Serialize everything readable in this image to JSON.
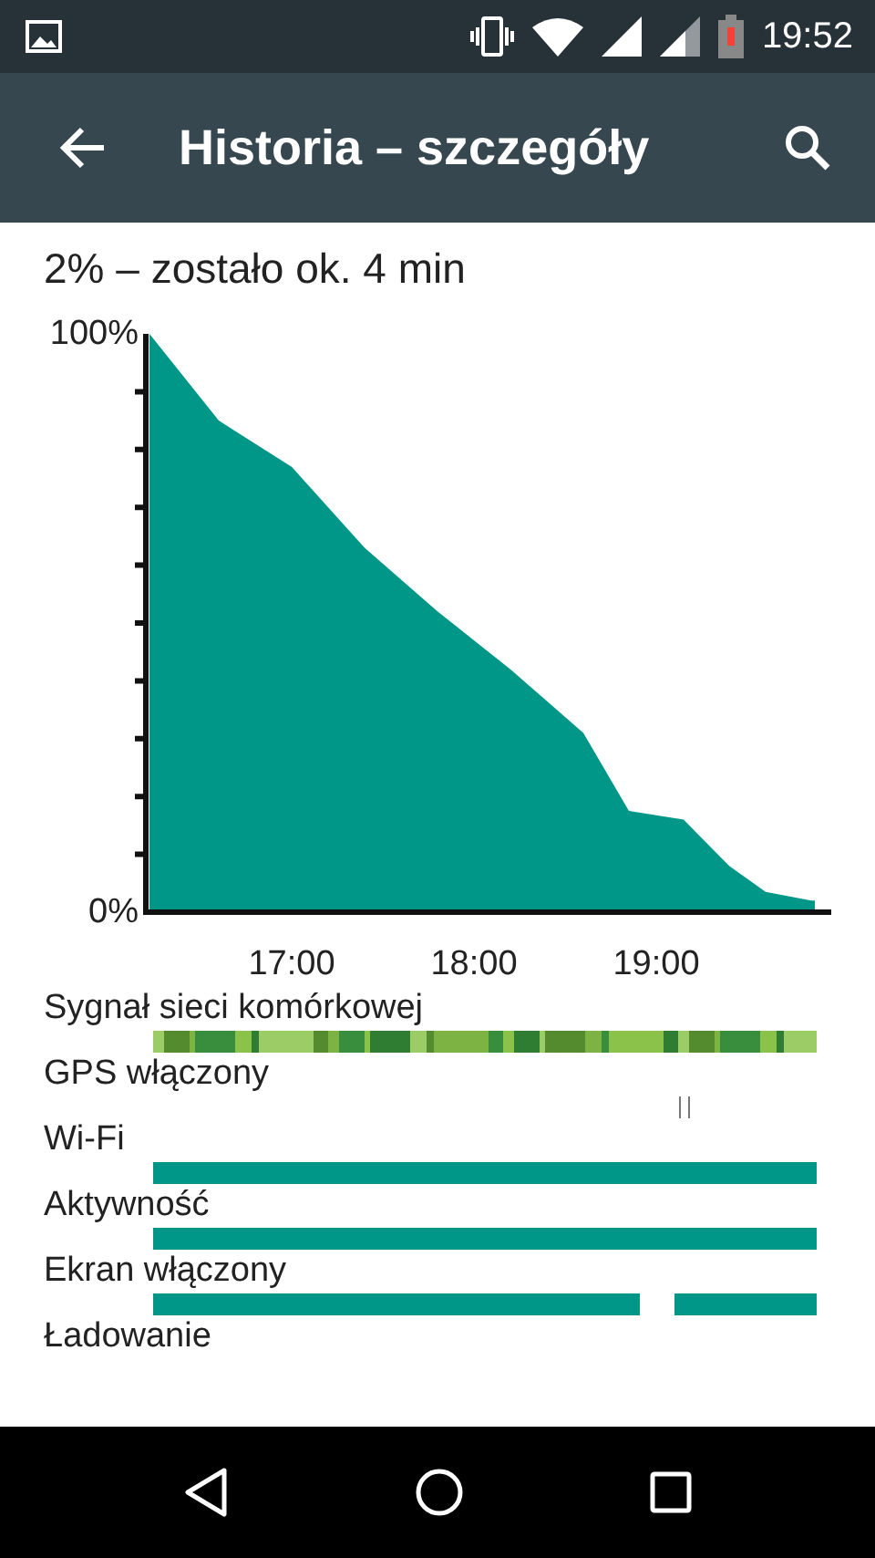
{
  "status_bar": {
    "time": "19:52"
  },
  "toolbar": {
    "title": "Historia – szczegóły"
  },
  "summary": "2% – zostało ok. 4 min",
  "chart": {
    "chart_data": {
      "type": "area",
      "x": [
        16.22,
        16.6,
        17,
        17.4,
        17.8,
        18.2,
        18.6,
        18.85,
        19.15,
        19.4,
        19.6,
        19.85
      ],
      "series": [
        {
          "color": "#009688",
          "values": [
            100,
            85,
            77,
            63,
            52,
            42,
            31,
            17.5,
            16,
            8,
            3.5,
            2
          ]
        }
      ],
      "xlim": [
        16.2,
        19.95
      ],
      "ylim": [
        0,
        100
      ],
      "xticks": [
        {
          "value": 17,
          "label": "17:00"
        },
        {
          "value": 18,
          "label": "18:00"
        },
        {
          "value": 19,
          "label": "19:00"
        }
      ],
      "yticks": [
        {
          "value": 0,
          "label": "0%"
        },
        {
          "value": 100,
          "label": "100%"
        }
      ]
    }
  },
  "usage_rows": [
    {
      "label": "Sygnał sieci komórkowej",
      "kind": "signal"
    },
    {
      "label": "GPS włączony",
      "kind": "ticks"
    },
    {
      "label": "Wi-Fi",
      "kind": "full"
    },
    {
      "label": "Aktywność",
      "kind": "full"
    },
    {
      "label": "Ekran włączony",
      "kind": "split"
    },
    {
      "label": "Ładowanie",
      "kind": "none"
    }
  ]
}
